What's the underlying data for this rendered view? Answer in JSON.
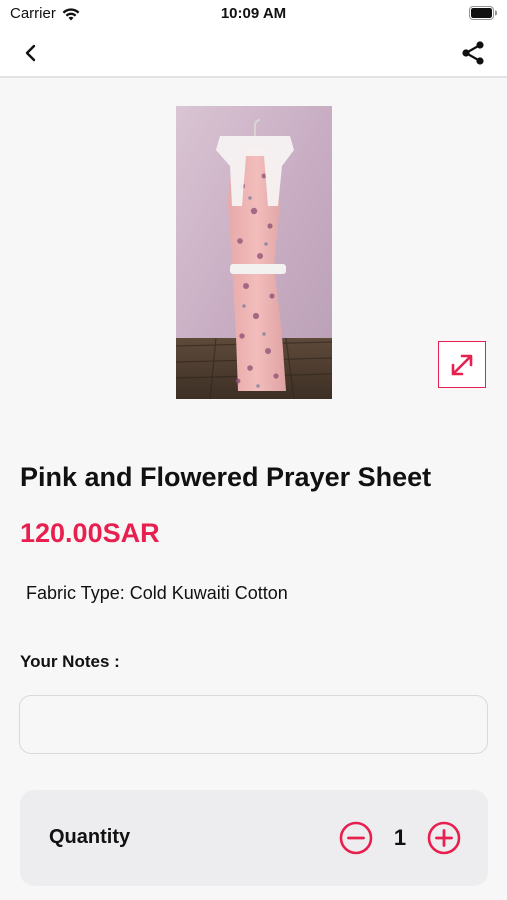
{
  "status_bar": {
    "carrier": "Carrier",
    "time": "10:09 AM",
    "wifi_icon": "wifi-icon",
    "battery_icon": "battery-icon"
  },
  "nav": {
    "back_icon": "chevron-left-icon",
    "share_icon": "share-icon"
  },
  "product": {
    "image_description_icon": "product-photo",
    "expand_icon": "expand-icon",
    "title": "Pink and Flowered Prayer Sheet",
    "price": "120.00SAR",
    "fabric_type": "Fabric Type: Cold Kuwaiti Cotton"
  },
  "notes": {
    "label": "Your Notes :",
    "value": "",
    "placeholder": ""
  },
  "quantity": {
    "label": "Quantity",
    "value": "1",
    "minus_icon": "minus-circle-icon",
    "plus_icon": "plus-circle-icon"
  },
  "colors": {
    "accent": "#e8204f",
    "background": "#f7f7f8",
    "card": "#ededf0",
    "text": "#111111"
  }
}
